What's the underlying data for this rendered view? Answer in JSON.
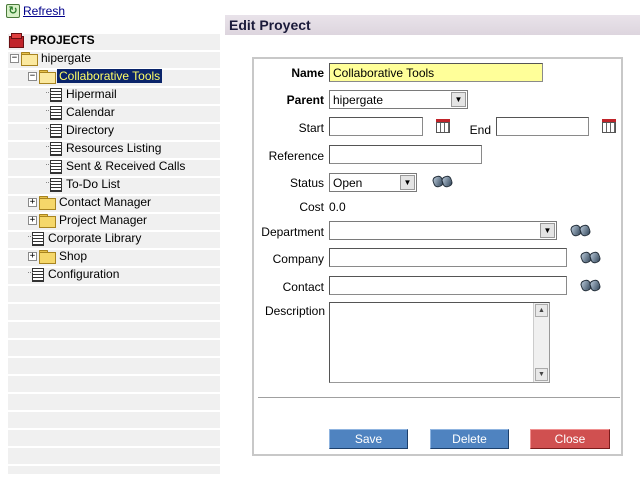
{
  "toolbar": {
    "refresh_label": "Refresh"
  },
  "tree": {
    "root": "PROJECTS",
    "project": "hipergate",
    "selected": "Collaborative Tools",
    "children": [
      "Hipermail",
      "Calendar",
      "Directory",
      "Resources Listing",
      "Sent & Received Calls",
      "To-Do List"
    ],
    "siblings": [
      "Contact Manager",
      "Project Manager",
      "Corporate Library",
      "Shop",
      "Configuration"
    ]
  },
  "header": {
    "title": "Edit Proyect"
  },
  "form": {
    "name_label": "Name",
    "name_value": "Collaborative Tools",
    "parent_label": "Parent",
    "parent_value": "hipergate",
    "start_label": "Start",
    "start_value": "",
    "end_label": "End",
    "end_value": "",
    "reference_label": "Reference",
    "reference_value": "",
    "status_label": "Status",
    "status_value": "Open",
    "cost_label": "Cost",
    "cost_value": "0.0",
    "department_label": "Department",
    "department_value": "",
    "company_label": "Company",
    "company_value": "",
    "contact_label": "Contact",
    "contact_value": "",
    "description_label": "Description",
    "description_value": ""
  },
  "buttons": {
    "save": "Save",
    "delete": "Delete",
    "close": "Close"
  },
  "colors": {
    "selected_bg": "#0a246a",
    "selected_text": "#ffff66",
    "name_highlight": "#ffff99",
    "primary_button": "#4f83c0",
    "close_button": "#d05050"
  }
}
